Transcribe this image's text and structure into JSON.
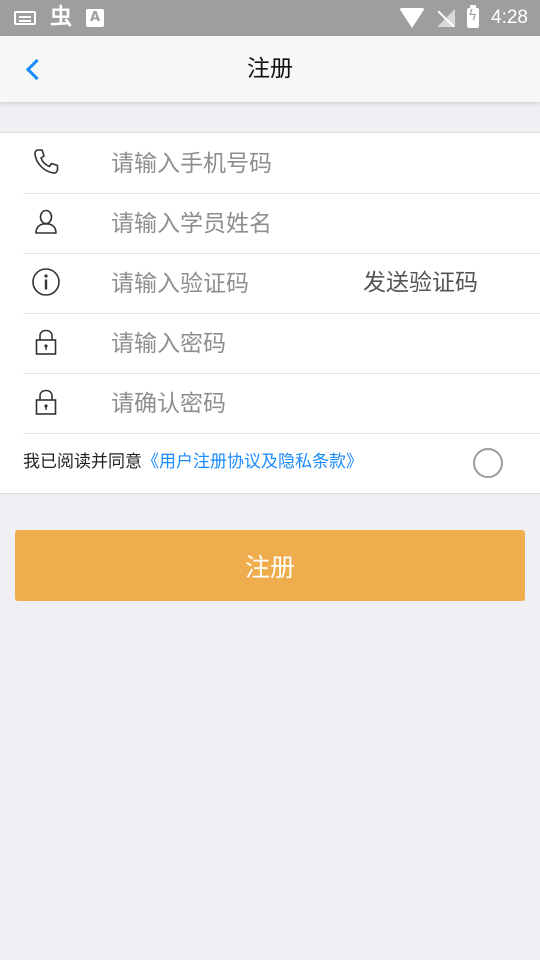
{
  "status_bar": {
    "time": "4:28",
    "left_icons": [
      "keyboard-icon",
      "bug-icon",
      "a-badge-icon"
    ],
    "right_icons": [
      "wifi-icon",
      "no-signal-icon",
      "battery-charging-icon"
    ]
  },
  "header": {
    "title": "注册",
    "back_icon": "chevron-left-icon"
  },
  "form": {
    "phone": {
      "placeholder": "请输入手机号码",
      "icon": "phone-icon"
    },
    "name": {
      "placeholder": "请输入学员姓名",
      "icon": "person-icon"
    },
    "code": {
      "placeholder": "请输入验证码",
      "icon": "info-icon",
      "send_label": "发送验证码"
    },
    "password": {
      "placeholder": "请输入密码",
      "icon": "lock-icon"
    },
    "confirm": {
      "placeholder": "请确认密码",
      "icon": "lock-icon"
    }
  },
  "agreement": {
    "prefix": "我已阅读并同意",
    "link": "《用户注册协议及隐私条款》",
    "checked": false
  },
  "submit": {
    "label": "注册"
  },
  "colors": {
    "accent": "#1a8cff",
    "button": "#efad4e",
    "background": "#efeff4",
    "status_bar": "#9e9e9e"
  }
}
